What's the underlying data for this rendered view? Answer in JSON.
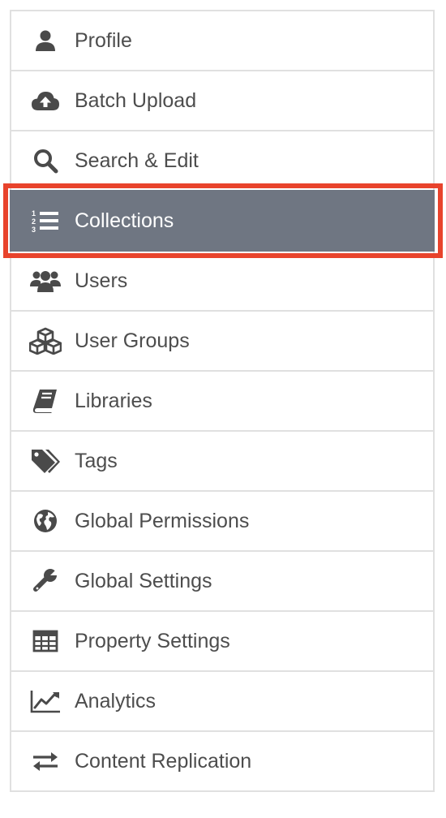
{
  "nav": {
    "items": [
      {
        "label": "Profile",
        "icon": "user-icon"
      },
      {
        "label": "Batch Upload",
        "icon": "cloud-upload-icon"
      },
      {
        "label": "Search & Edit",
        "icon": "search-icon"
      },
      {
        "label": "Collections",
        "icon": "ordered-list-icon",
        "selected": true
      },
      {
        "label": "Users",
        "icon": "users-icon"
      },
      {
        "label": "User Groups",
        "icon": "cubes-icon"
      },
      {
        "label": "Libraries",
        "icon": "book-icon"
      },
      {
        "label": "Tags",
        "icon": "tags-icon"
      },
      {
        "label": "Global Permissions",
        "icon": "globe-icon"
      },
      {
        "label": "Global Settings",
        "icon": "wrench-icon"
      },
      {
        "label": "Property Settings",
        "icon": "table-icon"
      },
      {
        "label": "Analytics",
        "icon": "line-chart-icon"
      },
      {
        "label": "Content Replication",
        "icon": "exchange-icon"
      }
    ]
  },
  "colors": {
    "active_background": "#6f7682",
    "highlight_border": "#e8432c",
    "text": "#4d4d4d",
    "icon": "#4a4a4a"
  }
}
